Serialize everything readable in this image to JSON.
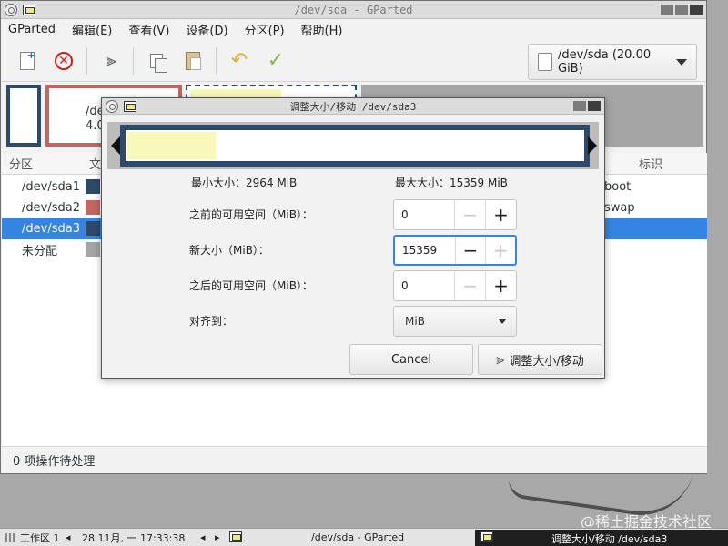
{
  "colors": {
    "partition_ext4": "#2e4a6b",
    "partition_swap": "#c06860",
    "unallocated": "#a5a5a5",
    "used_space": "#f8f8b8",
    "selection": "#3584e4"
  },
  "main_window": {
    "title": "/dev/sda - GParted",
    "menu": [
      "GParted",
      "编辑(E)",
      "查看(V)",
      "设备(D)",
      "分区(P)",
      "帮助(H)"
    ],
    "toolbar_icons": [
      "new-icon",
      "delete-icon",
      "resize-move-icon",
      "copy-icon",
      "paste-icon",
      "undo-icon",
      "apply-icon"
    ],
    "device": "/dev/sda (20.00 GiB)",
    "diskmap": {
      "sda2_name": "/de",
      "sda2_size": "4.0"
    },
    "columns": {
      "partition": "分区",
      "filesystem": "文",
      "flags": "标识"
    },
    "partitions": [
      {
        "name": "/dev/sda1",
        "flag": "boot"
      },
      {
        "name": "/dev/sda2",
        "flag": "swap"
      },
      {
        "name": "/dev/sda3",
        "flag": ""
      },
      {
        "name": "未分配",
        "flag": ""
      }
    ],
    "status": "0 项操作待处理"
  },
  "dialog": {
    "title": "调整大小/移动 /dev/sda3",
    "min_size": "最小大小：2964 MiB",
    "max_size": "最大大小：15359 MiB",
    "used_fraction": 0.193,
    "free_before_label": "之前的可用空间（MiB）：",
    "free_before_value": "0",
    "new_size_label": "新大小（MiB）：",
    "new_size_value": "15359",
    "free_after_label": "之后的可用空间（MiB）：",
    "free_after_value": "0",
    "align_label": "对齐到：",
    "align_value": "MiB",
    "cancel_label": "Cancel",
    "ok_label": "调整大小/移动"
  },
  "taskbar": {
    "workspace": "工作区 1",
    "datetime": "28 11月, 一 17:33:38",
    "task1": "/dev/sda - GParted",
    "task2": "调整大小/移动 /dev/sda3"
  },
  "watermark": "@稀土掘金技术社区"
}
